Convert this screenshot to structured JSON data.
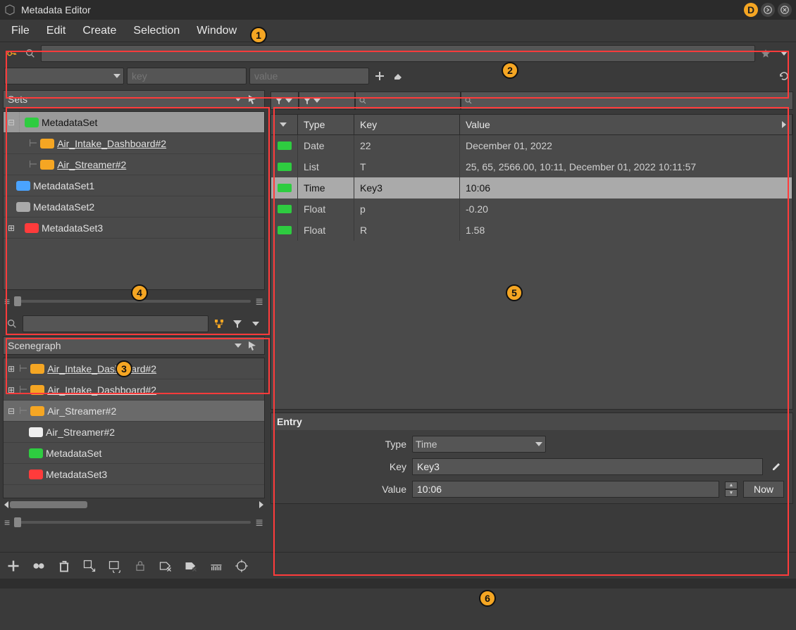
{
  "window": {
    "title": "Metadata Editor"
  },
  "menubar": [
    "File",
    "Edit",
    "Create",
    "Selection",
    "Window"
  ],
  "searchbar": {
    "key_placeholder": "key",
    "value_placeholder": "value"
  },
  "sets_panel": {
    "header": "Sets",
    "items": [
      {
        "exp": "minus",
        "indent": 0,
        "icon": "green",
        "label": "MetadataSet",
        "selected": true,
        "ul": false
      },
      {
        "exp": "",
        "indent": 1,
        "icon": "orange",
        "label": "Air_Intake_Dashboard#2",
        "pin": true,
        "ul": true
      },
      {
        "exp": "",
        "indent": 1,
        "icon": "orange",
        "label": "Air_Streamer#2",
        "pin": true,
        "ul": true
      },
      {
        "exp": "",
        "indent": 0,
        "icon": "blue",
        "label": "MetadataSet1"
      },
      {
        "exp": "",
        "indent": 0,
        "icon": "gray",
        "label": "MetadataSet2"
      },
      {
        "exp": "plus",
        "indent": 0,
        "icon": "red",
        "label": "MetadataSet3"
      }
    ]
  },
  "scenegraph_panel": {
    "header": "Scenegraph",
    "items": [
      {
        "exp": "plus",
        "indent": 0,
        "icon": "orange",
        "pin": true,
        "label": "Air_Intake_Dashboard#2",
        "ul": true
      },
      {
        "exp": "plus",
        "indent": 0,
        "icon": "orange",
        "pin": true,
        "label": "Air_Intake_Dashboard#2",
        "ul": true
      },
      {
        "exp": "minus",
        "indent": 0,
        "icon": "orange",
        "pin": true,
        "label": "Air_Streamer#2",
        "sel2": true
      },
      {
        "exp": "",
        "indent": 1,
        "icon": "white",
        "label": "Air_Streamer#2"
      },
      {
        "exp": "",
        "indent": 1,
        "icon": "green",
        "label": "MetadataSet"
      },
      {
        "exp": "",
        "indent": 1,
        "icon": "red",
        "label": "MetadataSet3"
      }
    ]
  },
  "table": {
    "columns": {
      "type": "Type",
      "key": "Key",
      "value": "Value"
    },
    "rows": [
      {
        "icon": "green",
        "type": "Date",
        "key": "22",
        "value": "December 01, 2022"
      },
      {
        "icon": "green",
        "type": "List",
        "key": "T",
        "value": "25, 65, 2566.00, 10:11, December 01, 2022 10:11:57"
      },
      {
        "icon": "green",
        "type": "Time",
        "key": "Key3",
        "value": "10:06",
        "selected": true
      },
      {
        "icon": "green",
        "type": "Float",
        "key": "p",
        "value": "-0.20"
      },
      {
        "icon": "green",
        "type": "Float",
        "key": "R",
        "value": "1.58"
      }
    ]
  },
  "entry": {
    "title": "Entry",
    "type_label": "Type",
    "type_value": "Time",
    "key_label": "Key",
    "key_value": "Key3",
    "value_label": "Value",
    "value_value": "10:06",
    "now_label": "Now"
  },
  "callouts": {
    "c1": "1",
    "c2": "2",
    "c3": "3",
    "c4": "4",
    "c5": "5",
    "c6": "6"
  }
}
